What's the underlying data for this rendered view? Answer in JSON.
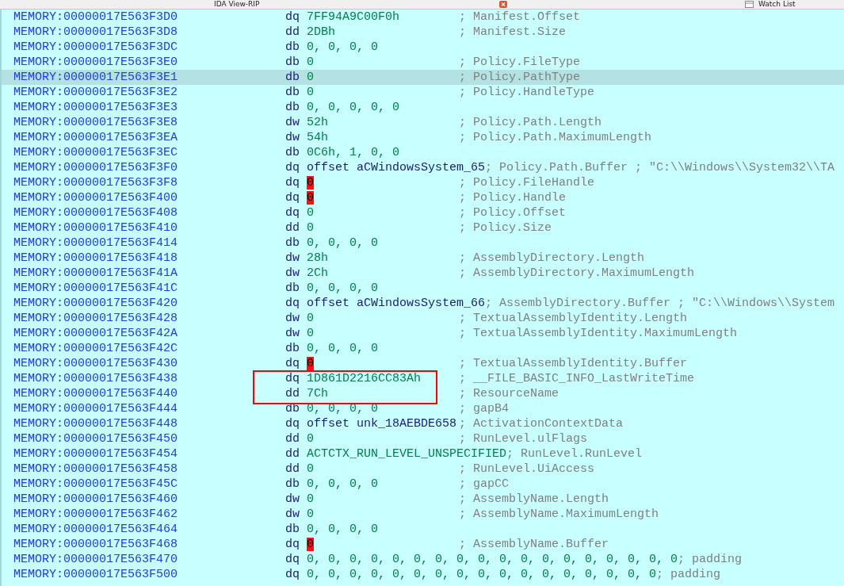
{
  "tabs": [
    {
      "label": "IDA View-RIP",
      "kind": "closable"
    },
    {
      "label": "Watch List",
      "kind": "pane"
    }
  ],
  "listing": {
    "rows": [
      {
        "address": "MEMORY:00000017E563F3D0",
        "mnemonic": "dq",
        "operand": "7FF94A9C00F0h",
        "kind": "number",
        "comment": "; Manifest.Offset",
        "flagged": false,
        "selected": false,
        "boxed": false
      },
      {
        "address": "MEMORY:00000017E563F3D8",
        "mnemonic": "dd",
        "operand": "2DBh",
        "kind": "number",
        "comment": "; Manifest.Size",
        "flagged": false,
        "selected": false,
        "boxed": false
      },
      {
        "address": "MEMORY:00000017E563F3DC",
        "mnemonic": "db",
        "operand": "0, 0, 0, 0",
        "kind": "number",
        "flagged": false,
        "selected": false,
        "boxed": false
      },
      {
        "address": "MEMORY:00000017E563F3E0",
        "mnemonic": "db",
        "operand": "0",
        "kind": "number",
        "comment": "; Policy.FileType",
        "flagged": false,
        "selected": false,
        "boxed": false
      },
      {
        "address": "MEMORY:00000017E563F3E1",
        "mnemonic": "db",
        "operand": "0",
        "kind": "number",
        "comment": "; Policy.PathType",
        "flagged": false,
        "selected": true,
        "boxed": false
      },
      {
        "address": "MEMORY:00000017E563F3E2",
        "mnemonic": "db",
        "operand": "0",
        "kind": "number",
        "comment": "; Policy.HandleType",
        "flagged": false,
        "selected": false,
        "boxed": false
      },
      {
        "address": "MEMORY:00000017E563F3E3",
        "mnemonic": "db",
        "operand": "0, 0, 0, 0, 0",
        "kind": "number",
        "flagged": false,
        "selected": false,
        "boxed": false
      },
      {
        "address": "MEMORY:00000017E563F3E8",
        "mnemonic": "dw",
        "operand": "52h",
        "kind": "number",
        "comment": "; Policy.Path.Length",
        "flagged": false,
        "selected": false,
        "boxed": false
      },
      {
        "address": "MEMORY:00000017E563F3EA",
        "mnemonic": "dw",
        "operand": "54h",
        "kind": "number",
        "comment": "; Policy.Path.MaximumLength",
        "flagged": false,
        "selected": false,
        "boxed": false
      },
      {
        "address": "MEMORY:00000017E563F3EC",
        "mnemonic": "db",
        "operand": "0C6h, 1, 0, 0",
        "kind": "number",
        "flagged": false,
        "selected": false,
        "boxed": false
      },
      {
        "address": "MEMORY:00000017E563F3F0",
        "mnemonic": "dq",
        "operand": "offset aCWindowsSystem_65",
        "kind": "symbol",
        "comment": "; Policy.Path.Buffer ; \"C:\\\\Windows\\\\System32\\\\TA",
        "flagged": false,
        "selected": false,
        "boxed": false
      },
      {
        "address": "MEMORY:00000017E563F3F8",
        "mnemonic": "dq",
        "operand": "0",
        "kind": "number",
        "comment": "; Policy.FileHandle",
        "flagged": true,
        "selected": false,
        "boxed": false
      },
      {
        "address": "MEMORY:00000017E563F400",
        "mnemonic": "dq",
        "operand": "0",
        "kind": "number",
        "comment": "; Policy.Handle",
        "flagged": true,
        "selected": false,
        "boxed": false
      },
      {
        "address": "MEMORY:00000017E563F408",
        "mnemonic": "dq",
        "operand": "0",
        "kind": "number",
        "comment": "; Policy.Offset",
        "flagged": false,
        "selected": false,
        "boxed": false
      },
      {
        "address": "MEMORY:00000017E563F410",
        "mnemonic": "dd",
        "operand": "0",
        "kind": "number",
        "comment": "; Policy.Size",
        "flagged": false,
        "selected": false,
        "boxed": false
      },
      {
        "address": "MEMORY:00000017E563F414",
        "mnemonic": "db",
        "operand": "0, 0, 0, 0",
        "kind": "number",
        "flagged": false,
        "selected": false,
        "boxed": false
      },
      {
        "address": "MEMORY:00000017E563F418",
        "mnemonic": "dw",
        "operand": "28h",
        "kind": "number",
        "comment": "; AssemblyDirectory.Length",
        "flagged": false,
        "selected": false,
        "boxed": false
      },
      {
        "address": "MEMORY:00000017E563F41A",
        "mnemonic": "dw",
        "operand": "2Ch",
        "kind": "number",
        "comment": "; AssemblyDirectory.MaximumLength",
        "flagged": false,
        "selected": false,
        "boxed": false
      },
      {
        "address": "MEMORY:00000017E563F41C",
        "mnemonic": "db",
        "operand": "0, 0, 0, 0",
        "kind": "number",
        "flagged": false,
        "selected": false,
        "boxed": false
      },
      {
        "address": "MEMORY:00000017E563F420",
        "mnemonic": "dq",
        "operand": "offset aCWindowsSystem_66",
        "kind": "symbol",
        "comment": "; AssemblyDirectory.Buffer ; \"C:\\\\Windows\\\\System",
        "flagged": false,
        "selected": false,
        "boxed": false
      },
      {
        "address": "MEMORY:00000017E563F428",
        "mnemonic": "dw",
        "operand": "0",
        "kind": "number",
        "comment": "; TextualAssemblyIdentity.Length",
        "flagged": false,
        "selected": false,
        "boxed": false
      },
      {
        "address": "MEMORY:00000017E563F42A",
        "mnemonic": "dw",
        "operand": "0",
        "kind": "number",
        "comment": "; TextualAssemblyIdentity.MaximumLength",
        "flagged": false,
        "selected": false,
        "boxed": false
      },
      {
        "address": "MEMORY:00000017E563F42C",
        "mnemonic": "db",
        "operand": "0, 0, 0, 0",
        "kind": "number",
        "flagged": false,
        "selected": false,
        "boxed": false
      },
      {
        "address": "MEMORY:00000017E563F430",
        "mnemonic": "dq",
        "operand": "0",
        "kind": "number",
        "comment": "; TextualAssemblyIdentity.Buffer",
        "flagged": true,
        "selected": false,
        "boxed": false
      },
      {
        "address": "MEMORY:00000017E563F438",
        "mnemonic": "dq",
        "operand": "1D861D2216CC83Ah",
        "kind": "number",
        "comment": "; __FILE_BASIC_INFO_LastWriteTime",
        "flagged": false,
        "selected": false,
        "boxed": true
      },
      {
        "address": "MEMORY:00000017E563F440",
        "mnemonic": "dd",
        "operand": "7Ch",
        "kind": "number",
        "comment": "; ResourceName",
        "flagged": false,
        "selected": false,
        "boxed": true
      },
      {
        "address": "MEMORY:00000017E563F444",
        "mnemonic": "db",
        "operand": "0, 0, 0, 0",
        "kind": "number",
        "comment": "; gapB4",
        "flagged": false,
        "selected": false,
        "boxed": false
      },
      {
        "address": "MEMORY:00000017E563F448",
        "mnemonic": "dq",
        "operand": "offset unk_18AEBDE658",
        "kind": "symbol",
        "comment": "; ActivationContextData",
        "flagged": false,
        "selected": false,
        "boxed": false
      },
      {
        "address": "MEMORY:00000017E563F450",
        "mnemonic": "dd",
        "operand": "0",
        "kind": "number",
        "comment": "; RunLevel.ulFlags",
        "flagged": false,
        "selected": false,
        "boxed": false
      },
      {
        "address": "MEMORY:00000017E563F454",
        "mnemonic": "dd",
        "operand": "ACTCTX_RUN_LEVEL_UNSPECIFIED",
        "kind": "number",
        "comment": "; RunLevel.RunLevel",
        "flagged": false,
        "selected": false,
        "boxed": false
      },
      {
        "address": "MEMORY:00000017E563F458",
        "mnemonic": "dd",
        "operand": "0",
        "kind": "number",
        "comment": "; RunLevel.UiAccess",
        "flagged": false,
        "selected": false,
        "boxed": false
      },
      {
        "address": "MEMORY:00000017E563F45C",
        "mnemonic": "db",
        "operand": "0, 0, 0, 0",
        "kind": "number",
        "comment": "; gapCC",
        "flagged": false,
        "selected": false,
        "boxed": false
      },
      {
        "address": "MEMORY:00000017E563F460",
        "mnemonic": "dw",
        "operand": "0",
        "kind": "number",
        "comment": "; AssemblyName.Length",
        "flagged": false,
        "selected": false,
        "boxed": false
      },
      {
        "address": "MEMORY:00000017E563F462",
        "mnemonic": "dw",
        "operand": "0",
        "kind": "number",
        "comment": "; AssemblyName.MaximumLength",
        "flagged": false,
        "selected": false,
        "boxed": false
      },
      {
        "address": "MEMORY:00000017E563F464",
        "mnemonic": "db",
        "operand": "0, 0, 0, 0",
        "kind": "number",
        "flagged": false,
        "selected": false,
        "boxed": false
      },
      {
        "address": "MEMORY:00000017E563F468",
        "mnemonic": "dq",
        "operand": "0",
        "kind": "number",
        "comment": "; AssemblyName.Buffer",
        "flagged": true,
        "selected": false,
        "boxed": false
      },
      {
        "address": "MEMORY:00000017E563F470",
        "mnemonic": "dq",
        "operand": "0, 0, 0, 0, 0, 0, 0, 0, 0, 0, 0, 0, 0, 0, 0, 0, 0, 0",
        "kind": "number",
        "comment": "; padding",
        "flagged": false,
        "selected": false,
        "boxed": false
      },
      {
        "address": "MEMORY:00000017E563F500",
        "mnemonic": "dq",
        "operand": "0, 0, 0, 0, 0, 0, 0, 0, 0, 0, 0, 0, 0, 0, 0, 0, 0",
        "kind": "number",
        "comment": "; padding",
        "flagged": false,
        "selected": false,
        "boxed": false
      }
    ]
  }
}
